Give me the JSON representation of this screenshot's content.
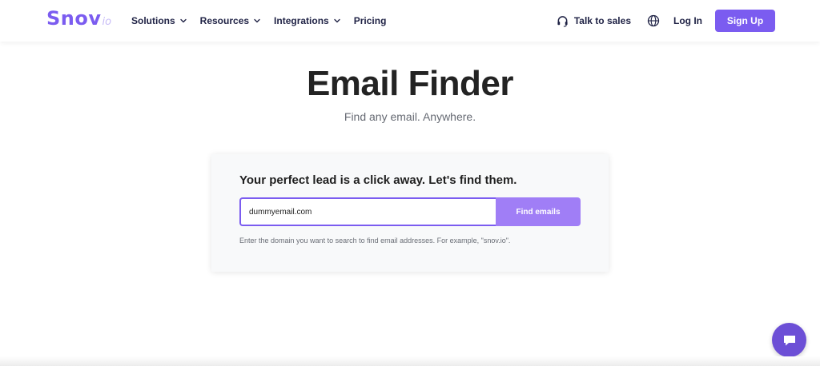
{
  "header": {
    "logo": {
      "main": "Snov",
      "sub": "io"
    },
    "nav": [
      {
        "label": "Solutions",
        "has_dropdown": true
      },
      {
        "label": "Resources",
        "has_dropdown": true
      },
      {
        "label": "Integrations",
        "has_dropdown": true
      },
      {
        "label": "Pricing",
        "has_dropdown": false
      }
    ],
    "talk_to_sales": "Talk to sales",
    "talk_icon": "headset-icon",
    "language_icon": "globe-icon",
    "login": "Log In",
    "signup": "Sign Up"
  },
  "hero": {
    "title": "Email Finder",
    "subtitle": "Find any email. Anywhere."
  },
  "search": {
    "heading": "Your perfect lead is a click away. Let's find them.",
    "input_value": "dummyemail.com",
    "button_label": "Find emails",
    "hint": "Enter the domain you want to search to find email addresses. For example, \"snov.io\"."
  },
  "chat": {
    "icon": "chat-bubble-icon"
  },
  "colors": {
    "brand": "#7b5cf0",
    "button_light": "#a07ef6",
    "chat": "#6c4fd6",
    "nav_text": "#1f2245"
  }
}
